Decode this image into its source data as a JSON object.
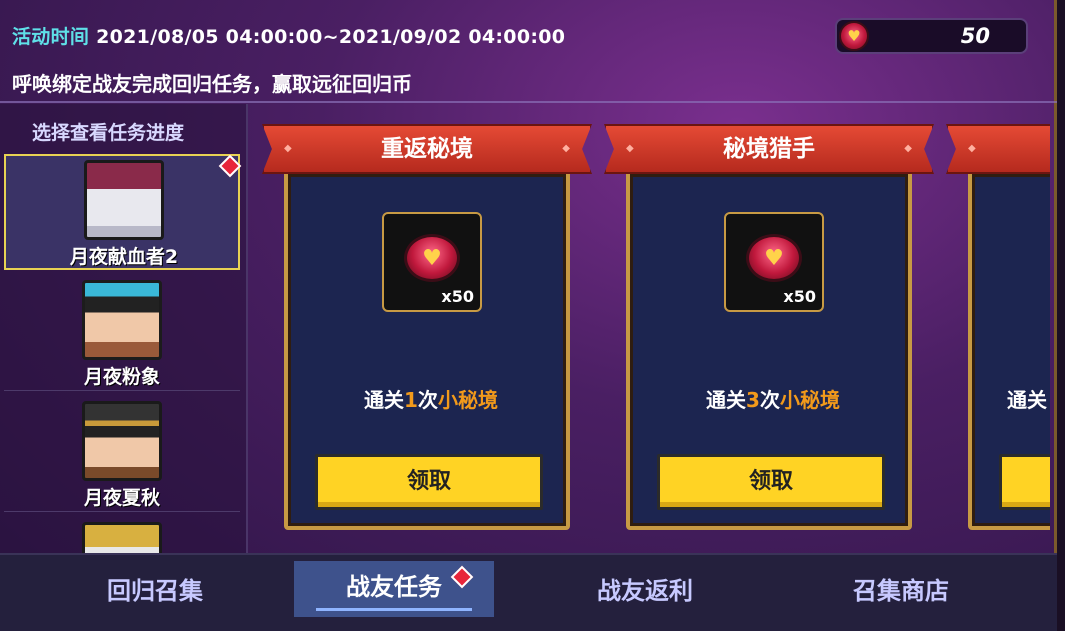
{
  "header": {
    "event_time_label": "活动时间",
    "event_time_value": "2021/08/05 04:00:00~2021/09/02 04:00:00",
    "subtitle": "呼唤绑定战友完成回归任务，赢取远征回归币"
  },
  "currency": {
    "icon": "heart-coin-icon",
    "amount": "50"
  },
  "sidebar": {
    "title": "选择查看任务进度",
    "characters": [
      {
        "name": "月夜献血者2",
        "selected": true,
        "has_badge": true
      },
      {
        "name": "月夜粉象",
        "selected": false,
        "has_badge": false
      },
      {
        "name": "月夜夏秋",
        "selected": false,
        "has_badge": false
      },
      {
        "name": "",
        "selected": false,
        "has_badge": false
      }
    ]
  },
  "tasks": [
    {
      "title": "重返秘境",
      "reward_qty": "x50",
      "req_prefix": "通关",
      "req_count": "1",
      "req_mid": "次",
      "req_target": "小秘境",
      "button": "领取"
    },
    {
      "title": "秘境猎手",
      "reward_qty": "x50",
      "req_prefix": "通关",
      "req_count": "3",
      "req_mid": "次",
      "req_target": "小秘境",
      "button": "领取"
    },
    {
      "title": "",
      "reward_qty": "",
      "req_prefix": "通关",
      "req_count": "",
      "req_mid": "",
      "req_target": "",
      "button": ""
    }
  ],
  "tabs": [
    {
      "label": "回归召集",
      "active": false
    },
    {
      "label": "战友任务",
      "active": true
    },
    {
      "label": "战友返利",
      "active": false
    },
    {
      "label": "召集商店",
      "active": false
    }
  ],
  "colors": {
    "accent_cyan": "#5fe0e8",
    "button_yellow": "#ffd324",
    "highlight_orange": "#f29a1b",
    "ribbon_red": "#d33a2a"
  }
}
